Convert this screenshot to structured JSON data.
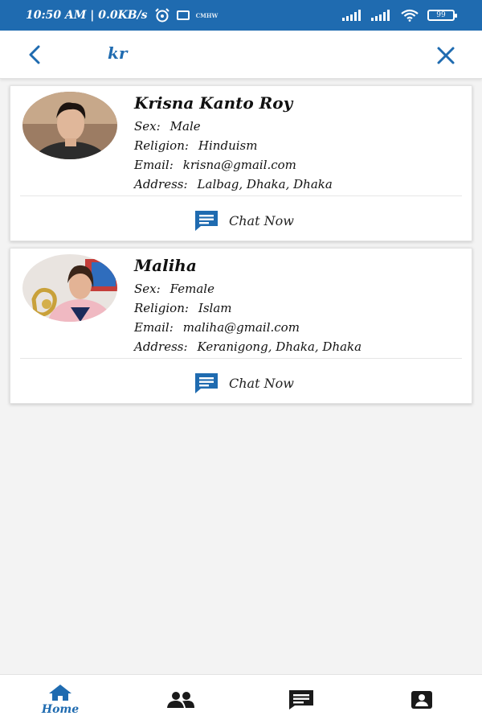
{
  "status_bar": {
    "time_speed": "10:50 AM | 0.0KB/s",
    "tiny_label": "CMHW",
    "battery": "99"
  },
  "search": {
    "value": "kr"
  },
  "results": [
    {
      "name": "Krisna Kanto Roy",
      "sex_label": "Sex:",
      "sex": "Male",
      "religion_label": "Religion:",
      "religion": "Hinduism",
      "email_label": "Email:",
      "email": "krisna@gmail.com",
      "address_label": "Address:",
      "address": "Lalbag, Dhaka, Dhaka",
      "chat_label": "Chat Now"
    },
    {
      "name": "Maliha",
      "sex_label": "Sex:",
      "sex": "Female",
      "religion_label": "Religion:",
      "religion": "Islam",
      "email_label": "Email:",
      "email": "maliha@gmail.com",
      "address_label": "Address:",
      "address": "Keranigong, Dhaka, Dhaka",
      "chat_label": "Chat Now"
    }
  ],
  "bottom_nav": {
    "home_label": "Home",
    "icons": [
      "home-icon",
      "people-icon",
      "chat-icon",
      "profile-icon"
    ]
  },
  "colors": {
    "primary": "#1f6bb0",
    "background": "#f3f3f3",
    "nav_icon": "#1a1a1a"
  }
}
